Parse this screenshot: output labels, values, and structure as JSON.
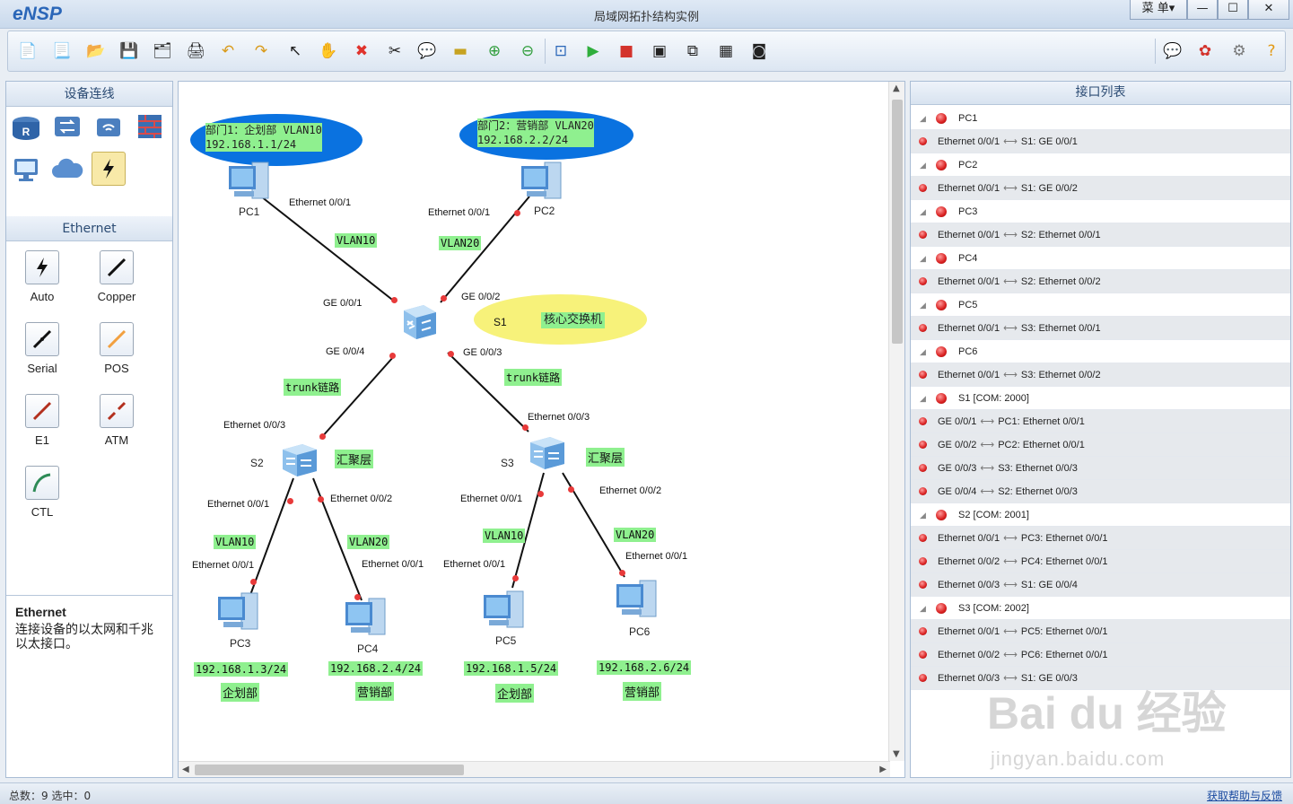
{
  "app": {
    "logo": "eNSP",
    "title": "局域网拓扑结构实例"
  },
  "window": {
    "menu_label": "菜 单▾",
    "minimize": "—",
    "maximize": "☐",
    "close": "✕"
  },
  "left_panel": {
    "devices_header": "设备连线",
    "ethernet_header": "Ethernet",
    "cables": [
      {
        "label": "Auto"
      },
      {
        "label": "Copper"
      },
      {
        "label": "Serial"
      },
      {
        "label": "POS"
      },
      {
        "label": "E1"
      },
      {
        "label": "ATM"
      },
      {
        "label": "CTL"
      }
    ],
    "description": {
      "title": "Ethernet",
      "text": "连接设备的以太网和千兆以太接口。"
    }
  },
  "topology": {
    "ellipses": [
      {
        "line1": "部门1：企划部 VLAN10",
        "line2": "192.168.1.1/24"
      },
      {
        "line1": "部门2：营销部 VLAN20",
        "line2": "192.168.2.2/24"
      },
      {
        "name": "S1",
        "text": "核心交换机"
      }
    ],
    "devices": {
      "pc1": "PC1",
      "pc2": "PC2",
      "pc3": "PC3",
      "pc4": "PC4",
      "pc5": "PC5",
      "pc6": "PC6",
      "s2": "S2",
      "s3": "S3"
    },
    "port_labels": {
      "pc1_eth": "Ethernet 0/0/1",
      "pc2_eth": "Ethernet 0/0/1",
      "s1_ge1": "GE 0/0/1",
      "s1_ge2": "GE 0/0/2",
      "s1_ge4": "GE 0/0/4",
      "s1_ge3": "GE 0/0/3",
      "s2_eth3": "Ethernet 0/0/3",
      "s3_eth3": "Ethernet 0/0/3",
      "s2_eth1": "Ethernet 0/0/1",
      "s2_eth2": "Ethernet 0/0/2",
      "s3_eth1": "Ethernet 0/0/1",
      "s3_eth2": "Ethernet 0/0/2",
      "pc3_eth": "Ethernet 0/0/1",
      "pc4_eth": "Ethernet 0/0/1",
      "pc5_eth": "Ethernet 0/0/1",
      "pc6_eth": "Ethernet 0/0/1"
    },
    "tags": {
      "vlan10_a": "VLAN10",
      "vlan20_a": "VLAN20",
      "trunk_a": "trunk链路",
      "trunk_b": "trunk链路",
      "agg_s2": "汇聚层",
      "agg_s3": "汇聚层",
      "vlan10_b": "VLAN10",
      "vlan20_b": "VLAN20",
      "vlan10_c": "VLAN10",
      "vlan20_c": "VLAN20",
      "ip_pc3": "192.168.1.3/24",
      "ip_pc4": "192.168.2.4/24",
      "ip_pc5": "192.168.1.5/24",
      "ip_pc6": "192.168.2.6/24",
      "dept_pc3": "企划部",
      "dept_pc4": "营销部",
      "dept_pc5": "企划部",
      "dept_pc6": "营销部"
    }
  },
  "interface_panel": {
    "header": "接口列表",
    "rows": [
      {
        "type": "device",
        "text": "PC1"
      },
      {
        "type": "iface",
        "a": "Ethernet 0/0/1",
        "b": "S1: GE 0/0/1"
      },
      {
        "type": "device",
        "text": "PC2"
      },
      {
        "type": "iface",
        "a": "Ethernet 0/0/1",
        "b": "S1: GE 0/0/2"
      },
      {
        "type": "device",
        "text": "PC3"
      },
      {
        "type": "iface",
        "a": "Ethernet 0/0/1",
        "b": "S2: Ethernet 0/0/1"
      },
      {
        "type": "device",
        "text": "PC4"
      },
      {
        "type": "iface",
        "a": "Ethernet 0/0/1",
        "b": "S2: Ethernet 0/0/2"
      },
      {
        "type": "device",
        "text": "PC5"
      },
      {
        "type": "iface",
        "a": "Ethernet 0/0/1",
        "b": "S3: Ethernet 0/0/1"
      },
      {
        "type": "device",
        "text": "PC6"
      },
      {
        "type": "iface",
        "a": "Ethernet 0/0/1",
        "b": "S3: Ethernet 0/0/2"
      },
      {
        "type": "device",
        "text": "S1 [COM: 2000]"
      },
      {
        "type": "iface",
        "a": "GE 0/0/1",
        "b": "PC1: Ethernet 0/0/1"
      },
      {
        "type": "iface",
        "a": "GE 0/0/2",
        "b": "PC2: Ethernet 0/0/1"
      },
      {
        "type": "iface",
        "a": "GE 0/0/3",
        "b": "S3: Ethernet 0/0/3"
      },
      {
        "type": "iface",
        "a": "GE 0/0/4",
        "b": "S2: Ethernet 0/0/3"
      },
      {
        "type": "device",
        "text": "S2 [COM: 2001]"
      },
      {
        "type": "iface",
        "a": "Ethernet 0/0/1",
        "b": "PC3: Ethernet 0/0/1"
      },
      {
        "type": "iface",
        "a": "Ethernet 0/0/2",
        "b": "PC4: Ethernet 0/0/1"
      },
      {
        "type": "iface",
        "a": "Ethernet 0/0/3",
        "b": "S1: GE 0/0/4"
      },
      {
        "type": "device",
        "text": "S3 [COM: 2002]"
      },
      {
        "type": "iface",
        "a": "Ethernet 0/0/1",
        "b": "PC5: Ethernet 0/0/1"
      },
      {
        "type": "iface",
        "a": "Ethernet 0/0/2",
        "b": "PC6: Ethernet 0/0/1"
      },
      {
        "type": "iface",
        "a": "Ethernet 0/0/3",
        "b": "S1: GE 0/0/3"
      }
    ]
  },
  "status": {
    "left": "总数：9  选中：0",
    "right": "获取帮助与反馈"
  },
  "watermark": {
    "brand": "Bai du 经验",
    "url": "jingyan.baidu.com"
  },
  "colors": {
    "accent": "#2a66b8",
    "tag_green": "#8ff08f",
    "ellipse_blue": "#0a72e0",
    "ellipse_yellow": "#f7f27a",
    "port_dot": "#e83a3a"
  }
}
